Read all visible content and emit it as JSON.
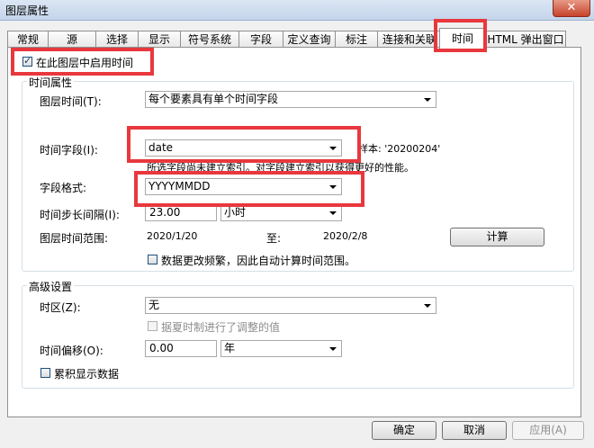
{
  "window": {
    "title": "图层属性",
    "close_glyph": "✕"
  },
  "tabs": [
    {
      "label": "常规"
    },
    {
      "label": "源"
    },
    {
      "label": "选择"
    },
    {
      "label": "显示"
    },
    {
      "label": "符号系统"
    },
    {
      "label": "字段"
    },
    {
      "label": "定义查询"
    },
    {
      "label": "标注"
    },
    {
      "label": "连接和关联"
    },
    {
      "label": "时间"
    },
    {
      "label": "HTML 弹出窗口"
    }
  ],
  "active_tab": "时间",
  "enable_time": {
    "label": "在此图层中启用时间",
    "checked": true
  },
  "time_props": {
    "title": "时间属性",
    "layer_time_label": "图层时间(T):",
    "layer_time_value": "每个要素具有单个时间字段",
    "time_field_label": "时间字段(I):",
    "time_field_value": "date",
    "sample_text": "样本: '20200204'",
    "index_hint": "所选字段尚未建立索引。对字段建立索引以获得更好的性能。",
    "field_format_label": "字段格式:",
    "field_format_value": "YYYYMMDD",
    "step_label": "时间步长间隔(I):",
    "step_value": "23.00",
    "step_unit": "小时",
    "extent_label": "图层时间范围:",
    "extent_start": "2020/1/20",
    "extent_to": "至:",
    "extent_end": "2020/2/8",
    "calc_button": "计算",
    "auto_calc_label": "数据更改频繁，因此自动计算时间范围。"
  },
  "advanced": {
    "title": "高级设置",
    "timezone_label": "时区(Z):",
    "timezone_value": "无",
    "dst_label": "据夏时制进行了调整的值",
    "offset_label": "时间偏移(O):",
    "offset_value": "0.00",
    "offset_unit": "年",
    "cumulative_label": "累积显示数据"
  },
  "footer": {
    "ok": "确定",
    "cancel": "取消",
    "apply": "应用(A)"
  },
  "colors": {
    "highlight": "#e8383d",
    "title_bar": "#c4d4ea"
  }
}
